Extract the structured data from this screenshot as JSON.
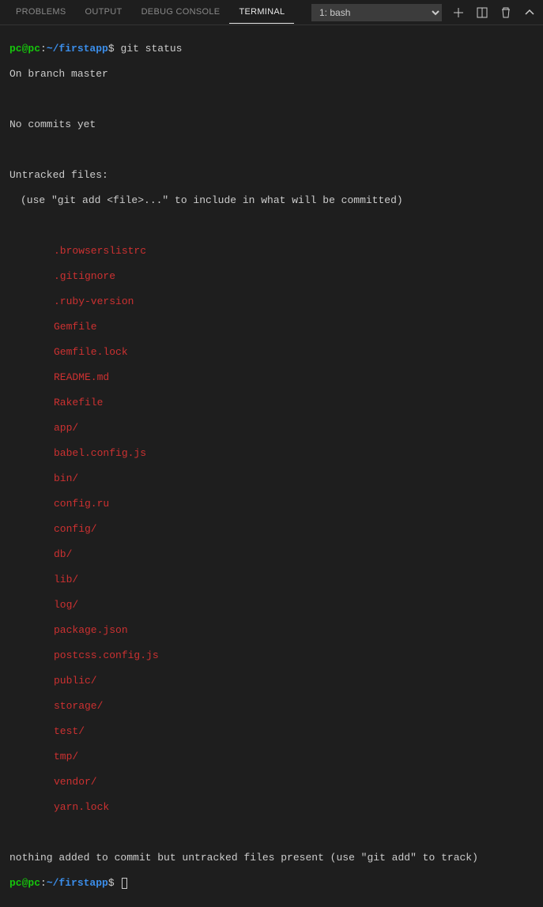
{
  "tabs": {
    "problems": "PROBLEMS",
    "output": "OUTPUT",
    "debug": "DEBUG CONSOLE",
    "terminal": "TERMINAL"
  },
  "shell": {
    "selected": "1: bash"
  },
  "prompt": {
    "user": "pc@pc",
    "sep": ":",
    "path": "~/firstapp",
    "dollar": "$"
  },
  "command1": "git status",
  "status": {
    "branch": "On branch master",
    "nocommits": "No commits yet",
    "untracked_header": "Untracked files:",
    "untracked_hint": "(use \"git add <file>...\" to include in what will be committed)",
    "footer": "nothing added to commit but untracked files present (use \"git add\" to track)"
  },
  "files": {
    "f0": ".browserslistrc",
    "f1": ".gitignore",
    "f2": ".ruby-version",
    "f3": "Gemfile",
    "f4": "Gemfile.lock",
    "f5": "README.md",
    "f6": "Rakefile",
    "f7": "app/",
    "f8": "babel.config.js",
    "f9": "bin/",
    "f10": "config.ru",
    "f11": "config/",
    "f12": "db/",
    "f13": "lib/",
    "f14": "log/",
    "f15": "package.json",
    "f16": "postcss.config.js",
    "f17": "public/",
    "f18": "storage/",
    "f19": "test/",
    "f20": "tmp/",
    "f21": "vendor/",
    "f22": "yarn.lock"
  }
}
